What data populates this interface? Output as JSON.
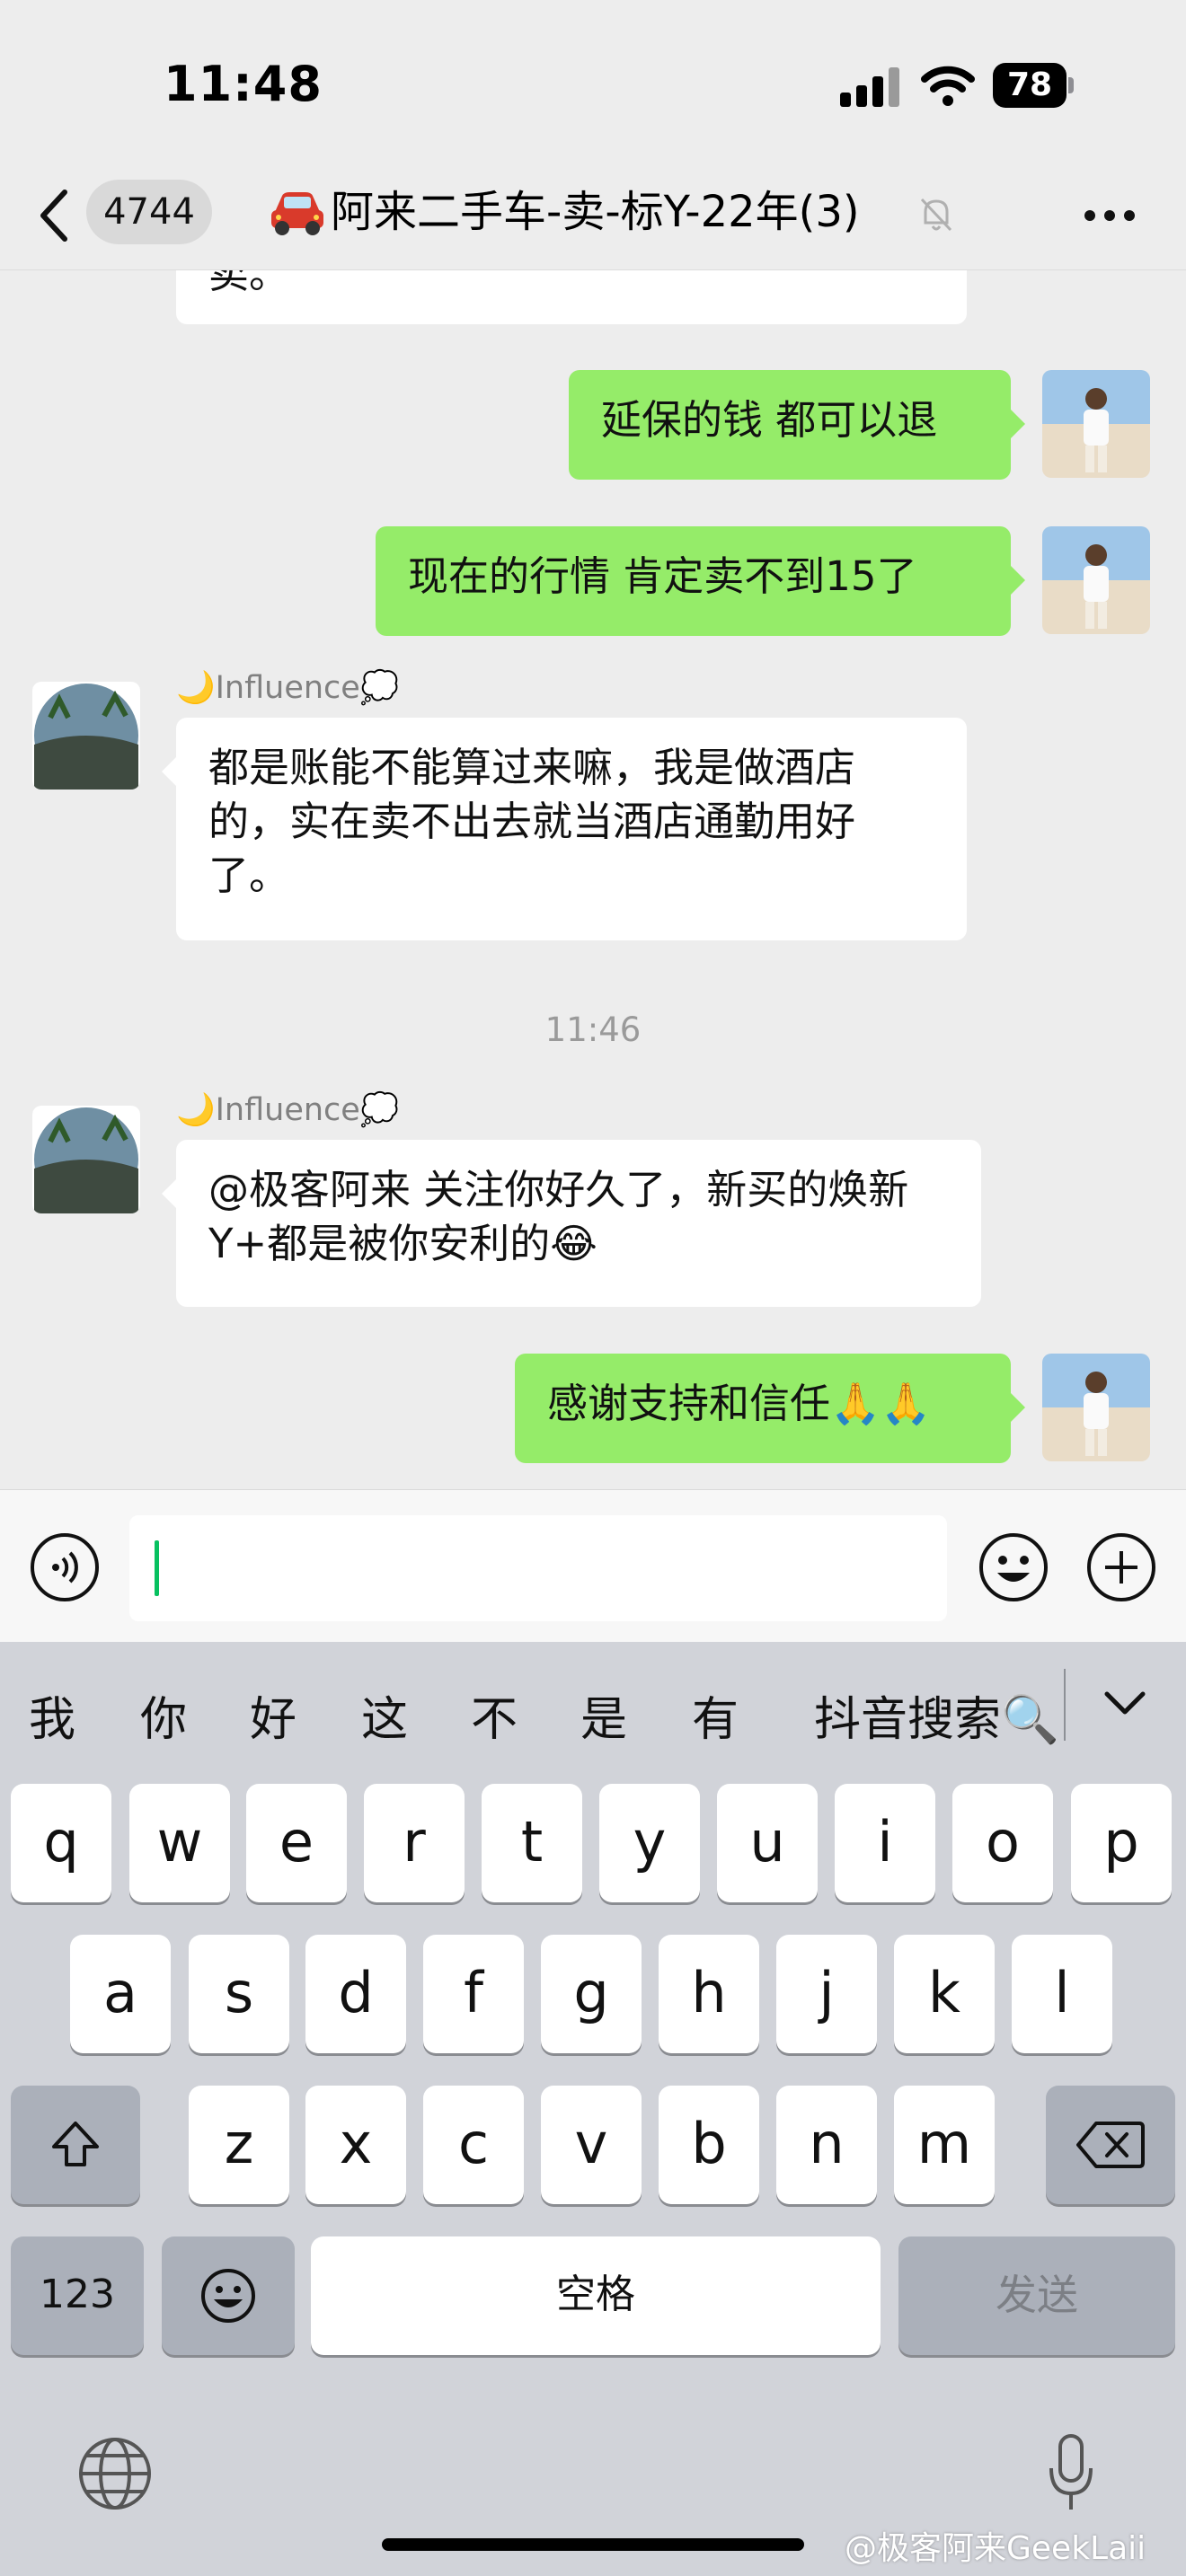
{
  "status_bar": {
    "time": "11:48",
    "battery": "78"
  },
  "nav": {
    "unread_count": "4744",
    "title": "阿来二手车-卖-标Y-22年(3)"
  },
  "messages": {
    "m0": {
      "text": "卖。"
    },
    "m1": {
      "text": "延保的钱 都可以退"
    },
    "m2": {
      "text": "现在的行情 肯定卖不到15了"
    },
    "m3": {
      "sender": "🌙Influence💭",
      "text": "都是账能不能算过来嘛，我是做酒店的，实在卖不出去就当酒店通勤用好了。"
    },
    "ts": "11:46",
    "m4": {
      "sender": "🌙Influence💭",
      "text": "@极客阿来 关注你好久了，新买的焕新Y+都是被你安利的😂"
    },
    "m5": {
      "text": "感谢支持和信任🙏🙏"
    }
  },
  "candidates": [
    "我",
    "你",
    "好",
    "这",
    "不",
    "是",
    "有",
    "抖音搜索🔍"
  ],
  "keys": {
    "row1": [
      "q",
      "w",
      "e",
      "r",
      "t",
      "y",
      "u",
      "i",
      "o",
      "p"
    ],
    "row2": [
      "a",
      "s",
      "d",
      "f",
      "g",
      "h",
      "j",
      "k",
      "l"
    ],
    "row3": [
      "z",
      "x",
      "c",
      "v",
      "b",
      "n",
      "m"
    ],
    "numbers": "123",
    "space": "空格",
    "send": "发送"
  },
  "watermark": "@极客阿来GeekLaii",
  "icons": {
    "back": "chevron-left-icon",
    "mute": "bell-slash-icon",
    "more": "ellipsis-icon",
    "voice": "voice-icon",
    "emoji": "emoji-icon",
    "add": "plus-circle-icon",
    "shift": "shift-icon",
    "delete": "backspace-icon",
    "globe": "globe-icon",
    "mic": "microphone-icon",
    "collapse": "chevron-down-icon"
  },
  "colors": {
    "outgoing_bubble": "#95ec69",
    "incoming_bubble": "#ffffff",
    "cursor": "#07c160"
  }
}
